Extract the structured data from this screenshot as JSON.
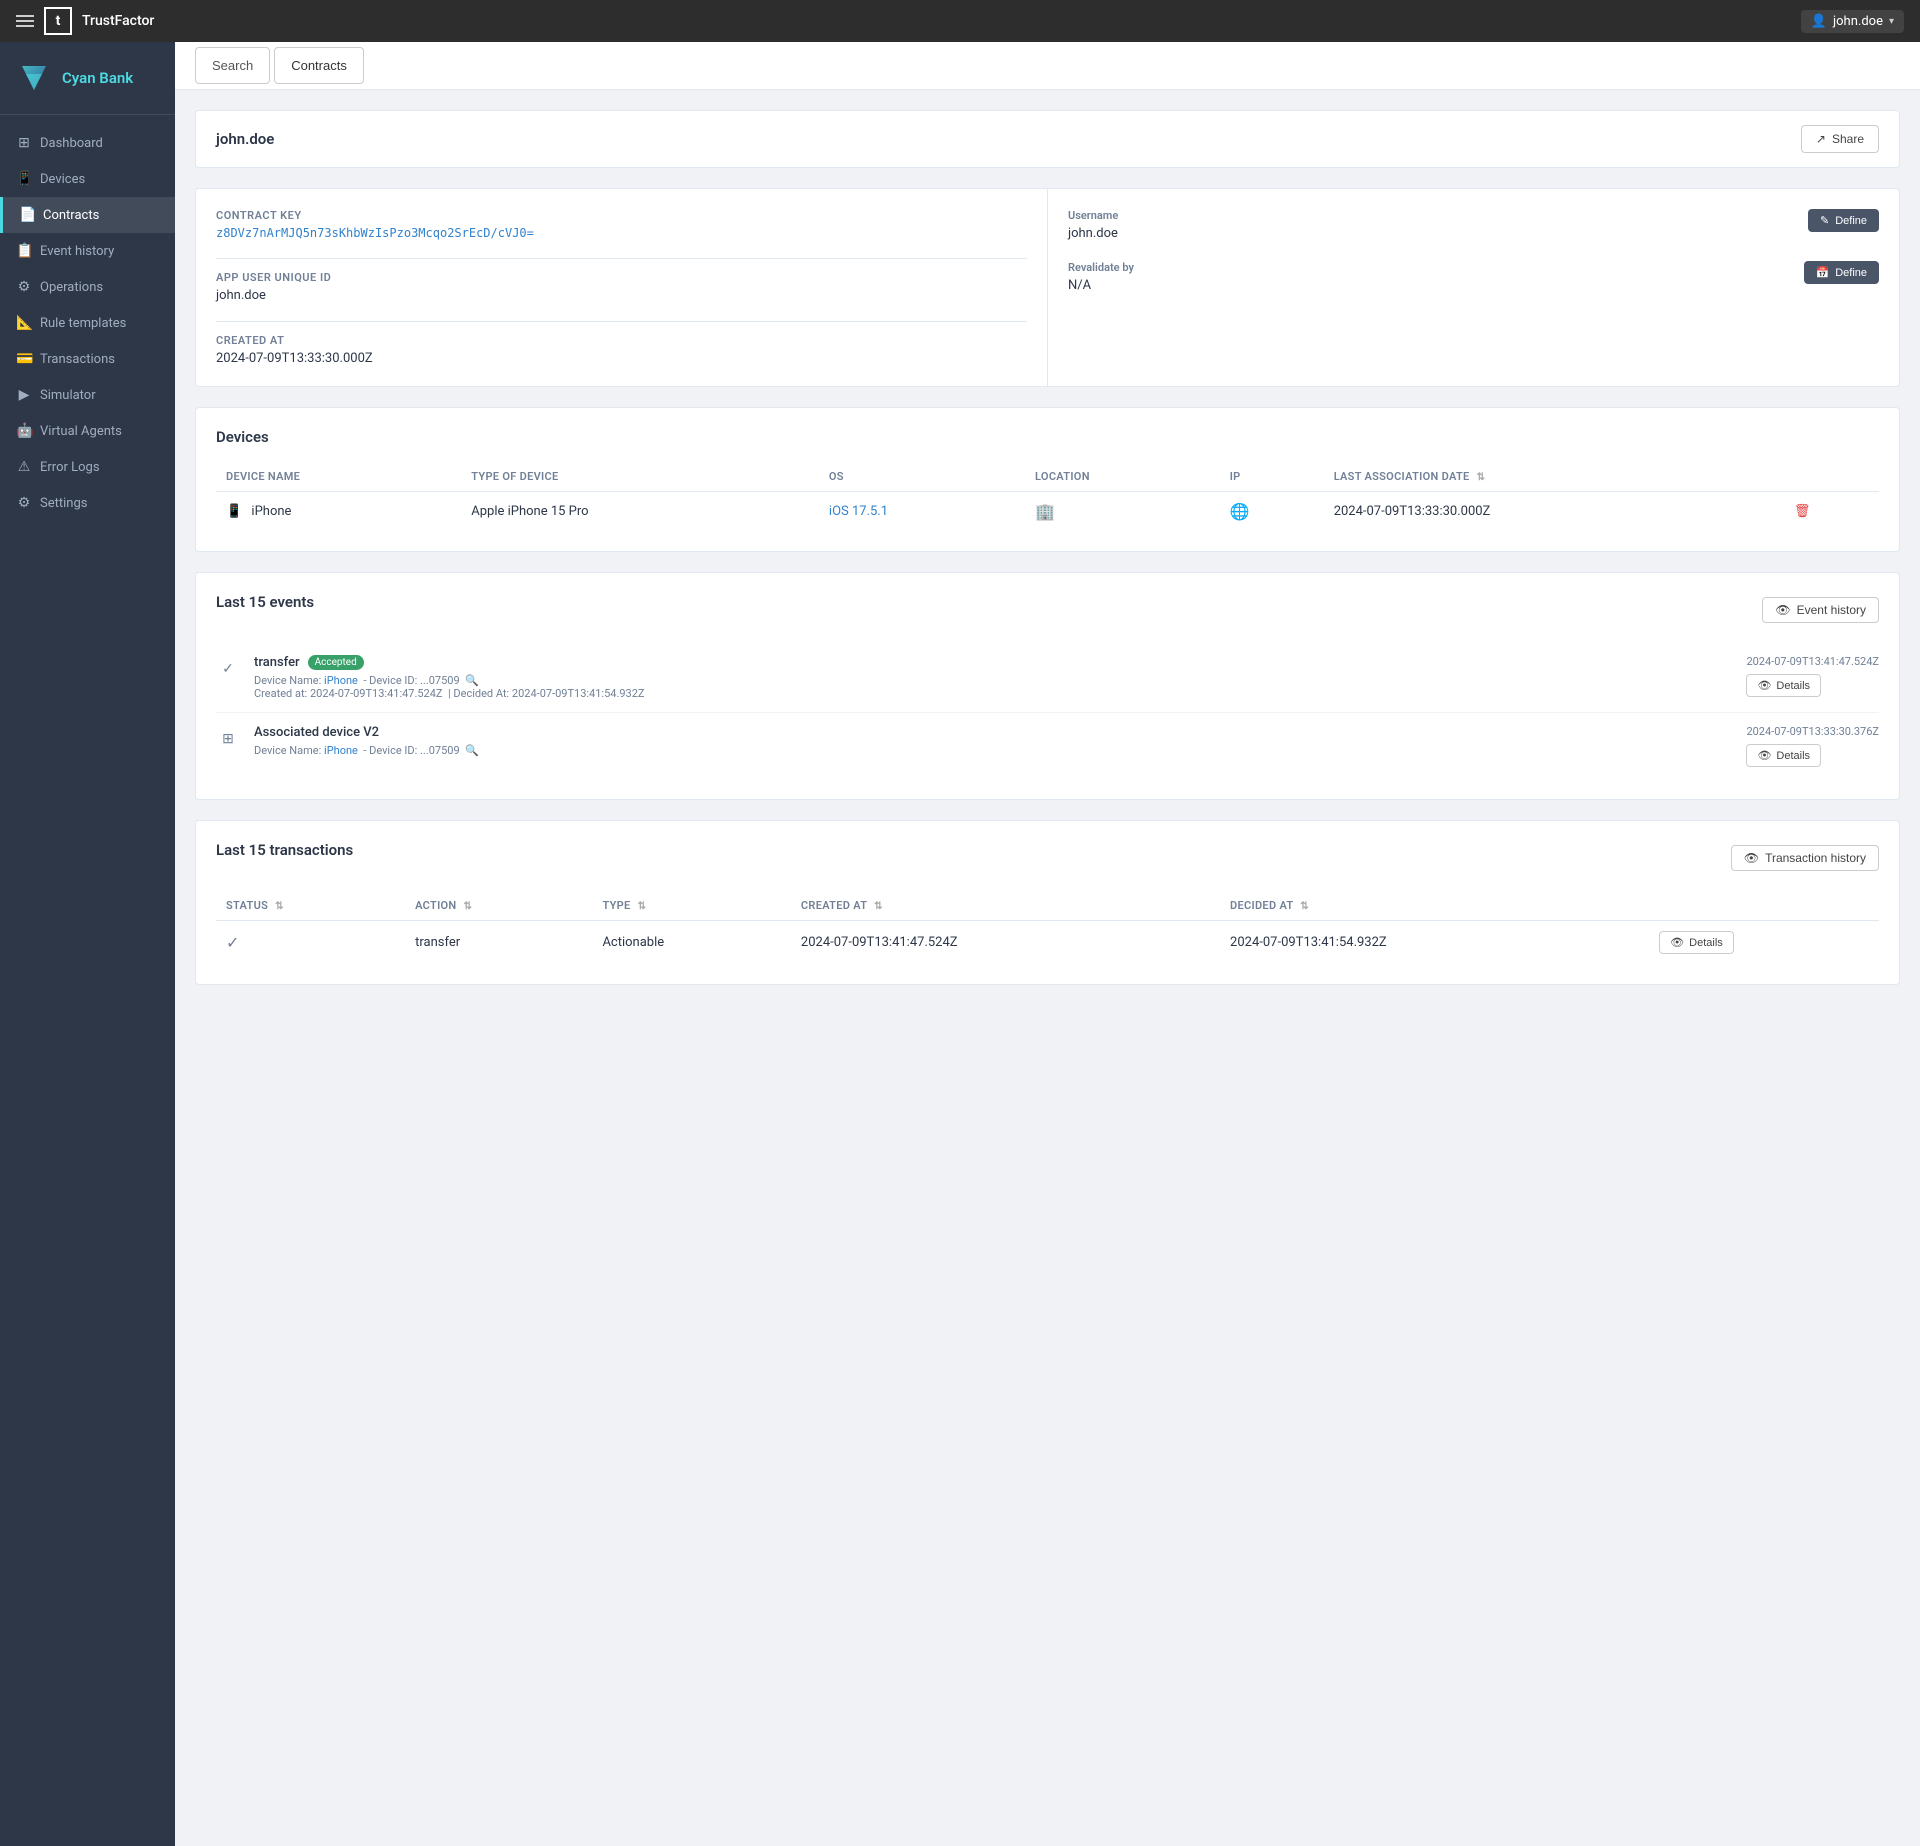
{
  "app": {
    "name": "TrustFactor",
    "user": "john.doe"
  },
  "sidebar": {
    "brand": "Cyan Bank",
    "items": [
      {
        "id": "dashboard",
        "label": "Dashboard",
        "icon": "⊞"
      },
      {
        "id": "devices",
        "label": "Devices",
        "icon": "📱"
      },
      {
        "id": "contracts",
        "label": "Contracts",
        "icon": "📄",
        "active": true
      },
      {
        "id": "event-history",
        "label": "Event history",
        "icon": "📋"
      },
      {
        "id": "operations",
        "label": "Operations",
        "icon": "⚙"
      },
      {
        "id": "rule-templates",
        "label": "Rule templates",
        "icon": "📐"
      },
      {
        "id": "transactions",
        "label": "Transactions",
        "icon": "💳"
      },
      {
        "id": "simulator",
        "label": "Simulator",
        "icon": "▶"
      },
      {
        "id": "virtual-agents",
        "label": "Virtual Agents",
        "icon": "🤖"
      },
      {
        "id": "error-logs",
        "label": "Error Logs",
        "icon": "⚠"
      },
      {
        "id": "settings",
        "label": "Settings",
        "icon": "⚙"
      }
    ]
  },
  "breadcrumbs": [
    {
      "label": "Search"
    },
    {
      "label": "Contracts",
      "active": true
    }
  ],
  "page": {
    "title": "john.doe",
    "share_label": "Share"
  },
  "contract": {
    "left": {
      "contract_key_label": "Contract Key",
      "contract_key_value": "z8DVz7nArMJQ5n73sKhbWzIsPzo3Mcqo2SrEcD/cVJ0=",
      "app_user_id_label": "APP User Unique ID",
      "app_user_id_value": "john.doe",
      "created_at_label": "Created at",
      "created_at_value": "2024-07-09T13:33:30.000Z"
    },
    "right": {
      "username_label": "Username",
      "username_value": "john.doe",
      "define1_label": "Define",
      "revalidate_label": "Revalidate by",
      "revalidate_value": "N/A",
      "define2_label": "Define"
    }
  },
  "devices": {
    "section_title": "Devices",
    "columns": [
      "Device Name",
      "Type of device",
      "OS",
      "Location",
      "IP",
      "Last association date"
    ],
    "rows": [
      {
        "name": "iPhone",
        "type": "Apple iPhone 15 Pro",
        "os": "iOS 17.5.1",
        "location": "building",
        "ip": "network",
        "date": "2024-07-09T13:33:30.000Z"
      }
    ]
  },
  "events": {
    "section_title": "Last 15 events",
    "event_history_btn": "Event history",
    "items": [
      {
        "icon": "✓",
        "name": "transfer",
        "badge": "Accepted",
        "badge_type": "success",
        "device_name": "iPhone",
        "device_id": "...07509",
        "created_at": "2024-07-09T13:41:47.524Z",
        "decided_at": "2024-07-09T13:41:54.932Z",
        "timestamp": "2024-07-09T13:41:47.524Z",
        "details_label": "Details"
      },
      {
        "icon": "⊞",
        "name": "Associated device V2",
        "badge": "",
        "badge_type": "",
        "device_name": "iPhone",
        "device_id": "...07509",
        "created_at": "",
        "decided_at": "",
        "timestamp": "2024-07-09T13:33:30.376Z",
        "details_label": "Details"
      }
    ]
  },
  "transactions": {
    "section_title": "Last 15 transactions",
    "tx_history_btn": "Transaction history",
    "columns": [
      "Status",
      "Action",
      "Type",
      "Created at",
      "Decided At"
    ],
    "rows": [
      {
        "status_icon": "✓",
        "action": "transfer",
        "type": "Actionable",
        "created_at": "2024-07-09T13:41:47.524Z",
        "decided_at": "2024-07-09T13:41:54.932Z",
        "details_label": "Details"
      }
    ]
  },
  "icons": {
    "hamburger": "☰",
    "user": "👤",
    "chevron_down": "▾",
    "share": "↗",
    "eye": "👁",
    "edit": "✎",
    "calendar": "📅",
    "search_mag": "🔍",
    "trash": "🗑",
    "sort": "⇅",
    "sort_up": "↑↓"
  }
}
